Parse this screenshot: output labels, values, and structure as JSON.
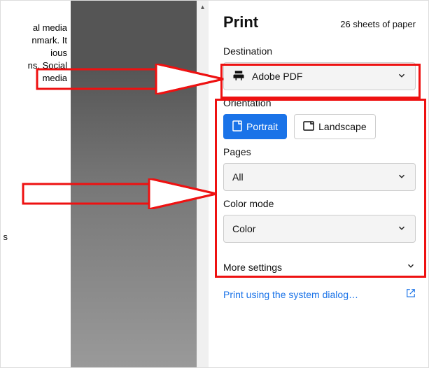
{
  "snippet": {
    "l1": "al media",
    "l2": "nmark. It",
    "l3": "ious",
    "l4": "ns, Social",
    "l5": "media",
    "tail": "s"
  },
  "header": {
    "title": "Print",
    "sheets": "26 sheets of paper"
  },
  "destination": {
    "label": "Destination",
    "value": "Adobe PDF"
  },
  "orientation": {
    "label": "Orientation",
    "portrait": "Portrait",
    "landscape": "Landscape"
  },
  "pages": {
    "label": "Pages",
    "value": "All"
  },
  "colormode": {
    "label": "Color mode",
    "value": "Color"
  },
  "more": {
    "label": "More settings"
  },
  "systemlink": {
    "label": "Print using the system dialog…"
  }
}
